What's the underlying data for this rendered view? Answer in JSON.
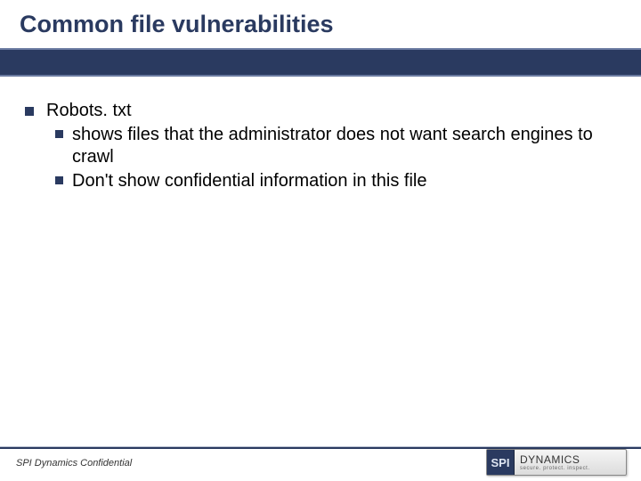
{
  "title": "Common file vulnerabilities",
  "bullets": [
    {
      "text": "Robots. txt",
      "children": [
        {
          "text": "shows files that the administrator does not want search engines to crawl"
        },
        {
          "text": "Don't show confidential information in this file"
        }
      ]
    }
  ],
  "footer": {
    "confidential": "SPI Dynamics Confidential"
  },
  "logo": {
    "badge": "SPI",
    "name": "DYNAMICS",
    "tagline": "secure. protect. inspect."
  }
}
